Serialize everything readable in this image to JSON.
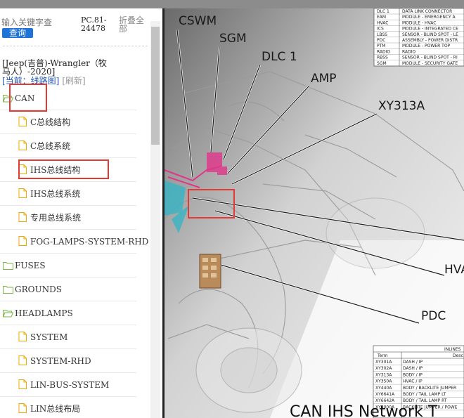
{
  "search": {
    "placeholder": "输入关键字查",
    "button_label": "查询"
  },
  "doc_code": "PC.81-24478",
  "collapse_all": "折叠全部",
  "vehicle": "[Jeep(吉普)-Wrangler（牧马人）-2020]",
  "current": {
    "label": "[当前：线路图]",
    "refresh": "[刷新]"
  },
  "tree": [
    {
      "label": "CAN",
      "level": 0,
      "icon": "folder-open-icon"
    },
    {
      "label": "C总线结构",
      "level": 1,
      "icon": "file-icon"
    },
    {
      "label": "C总线系统",
      "level": 1,
      "icon": "file-icon"
    },
    {
      "label": "IHS总线结构",
      "level": 1,
      "icon": "file-icon"
    },
    {
      "label": "IHS总线系统",
      "level": 1,
      "icon": "file-icon"
    },
    {
      "label": "专用总线系统",
      "level": 1,
      "icon": "file-icon"
    },
    {
      "label": "FOG-LAMPS-SYSTEM-RHD",
      "level": 1,
      "icon": "file-icon"
    },
    {
      "label": "FUSES",
      "level": 0,
      "icon": "folder-icon"
    },
    {
      "label": "GROUNDS",
      "level": 0,
      "icon": "folder-icon"
    },
    {
      "label": "HEADLAMPS",
      "level": 0,
      "icon": "folder-open-icon"
    },
    {
      "label": "SYSTEM",
      "level": 1,
      "icon": "file-icon"
    },
    {
      "label": "SYSTEM-RHD",
      "level": 1,
      "icon": "file-icon"
    },
    {
      "label": "LIN-BUS-SYSTEM",
      "level": 1,
      "icon": "file-icon"
    },
    {
      "label": "LIN总线布局",
      "level": 1,
      "icon": "file-icon"
    }
  ],
  "diagram": {
    "callouts": [
      "CSWM",
      "SGM",
      "DLC 1",
      "AMP",
      "XY313A",
      "HVA",
      "PDC"
    ],
    "bottom_title": "CAN IHS Network T",
    "legend_rows": [
      [
        "DLC 1",
        "DATA LINK CONNECTOR"
      ],
      [
        "EAM",
        "MODULE - EMERGENCY A"
      ],
      [
        "HVAC",
        "MODULE - HVAC"
      ],
      [
        "ICS",
        "MODULE - INTEGRATED CE"
      ],
      [
        "LBSS",
        "SENSOR - BLIND SPOT - LE"
      ],
      [
        "PDC",
        "ASSEMBLY - POWER DISTR"
      ],
      [
        "PTM",
        "MODULE - POWER TOP"
      ],
      [
        "RADIO",
        "RADIO"
      ],
      [
        "RBSS",
        "SENSOR - BLIND SPOT - RI"
      ],
      [
        "SGM",
        "MODULE - SECURITY GATE"
      ]
    ],
    "inline_table": {
      "title": "INLINES",
      "headers": [
        "Term",
        "Desc"
      ],
      "rows": [
        [
          "XY301A",
          "DASH / IP"
        ],
        [
          "XY302A",
          "DASH / IP"
        ],
        [
          "XY313A",
          "BODY / IP"
        ],
        [
          "XY350A",
          "HVAC / IP"
        ],
        [
          "XY440A",
          "BODY / BACKLITE JUMPER"
        ],
        [
          "XY6641A",
          "BODY / TAIL LAMP LT"
        ],
        [
          "XY6642A",
          "BODY / TAIL LAMP RT"
        ],
        [
          "XY9000A",
          "BACKLITE JUMPER / POWE"
        ]
      ]
    }
  },
  "colors": {
    "accent": "#1e73d8",
    "highlight": "#e53935",
    "folder": "#7ab648",
    "file": "#f0a800",
    "link": "#1a4fb3"
  }
}
